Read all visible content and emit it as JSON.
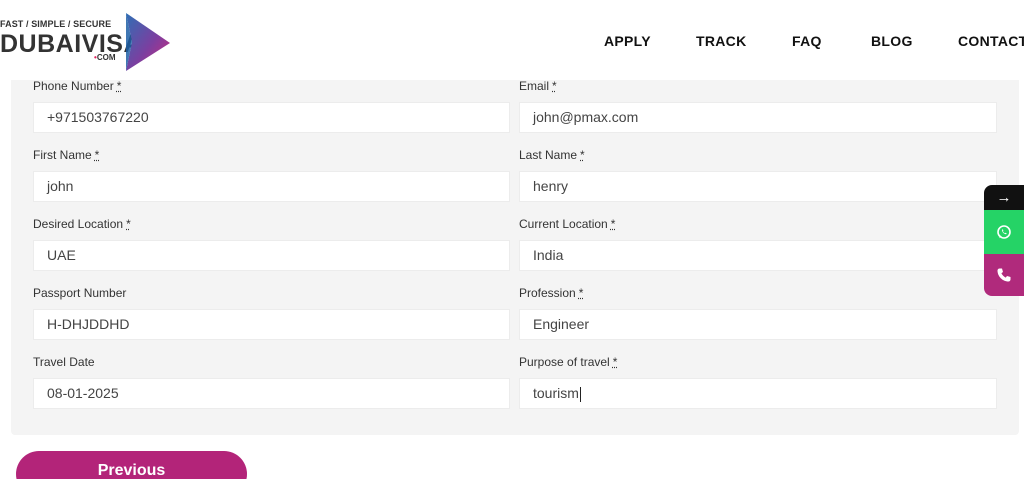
{
  "logo": {
    "tagline": "FAST / SIMPLE / SECURE",
    "name": "DUBAIVISA",
    "domain": "COM"
  },
  "nav": {
    "items": [
      "APPLY",
      "TRACK",
      "FAQ",
      "BLOG",
      "CONTACT"
    ]
  },
  "form": {
    "phone": {
      "label": "Phone Number",
      "value": "+971503767220"
    },
    "email": {
      "label": "Email",
      "value": "john@pmax.com"
    },
    "first_name": {
      "label": "First Name",
      "value": "john"
    },
    "last_name": {
      "label": "Last Name",
      "value": "henry"
    },
    "desired_location": {
      "label": "Desired Location",
      "value": "UAE"
    },
    "current_location": {
      "label": "Current Location",
      "value": "India"
    },
    "passport_number": {
      "label": "Passport Number",
      "value": "H-DHJDDHD"
    },
    "profession": {
      "label": "Profession",
      "value": "Engineer"
    },
    "travel_date": {
      "label": "Travel Date",
      "value": "08-01-2025"
    },
    "purpose": {
      "label": "Purpose of travel",
      "value": "tourism"
    },
    "required_mark": "*"
  },
  "side": {
    "arrow_glyph": "→",
    "whatsapp_icon": "whatsapp-icon",
    "phone_icon": "phone-icon"
  },
  "buttons": {
    "previous": "Previous"
  },
  "colors": {
    "brand": "#b32479",
    "whatsapp": "#25d366",
    "panel": "#f4f4f4"
  }
}
